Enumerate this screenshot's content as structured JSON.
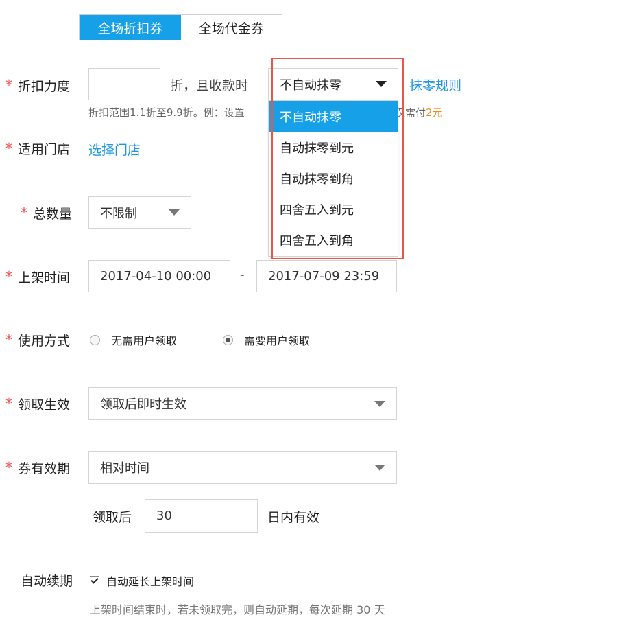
{
  "tabs": [
    {
      "label": "全场折扣券",
      "active": true
    },
    {
      "label": "全场代金券",
      "active": false
    }
  ],
  "required_mark": "*",
  "discount": {
    "label": "折扣力度",
    "value": "",
    "unit_text": "折，且收款时",
    "rounding_selected": "不自动抹零",
    "rounding_options": [
      "不自动抹零",
      "自动抹零到元",
      "自动抹零到角",
      "四舍五入到元",
      "四舍五入到角"
    ],
    "rules_link": "抹零规则",
    "hint_prefix": "折扣范围1.1折至9.9折。例：设置",
    "hint_hidden_suffix": "仅需付",
    "hint_amount": "2元"
  },
  "store": {
    "label": "适用门店",
    "link": "选择门店"
  },
  "quantity": {
    "label": "总数量",
    "value": "不限制"
  },
  "listing_time": {
    "label": "上架时间",
    "start": "2017-04-10 00:00",
    "separator": "-",
    "end": "2017-07-09 23:59"
  },
  "usage": {
    "label": "使用方式",
    "options": [
      {
        "label": "无需用户领取",
        "checked": false
      },
      {
        "label": "需要用户领取",
        "checked": true
      }
    ]
  },
  "effective": {
    "label": "领取生效",
    "value": "领取后即时生效"
  },
  "validity": {
    "label": "券有效期",
    "value": "相对时间",
    "prefix": "领取后",
    "days": "30",
    "suffix": "日内有效"
  },
  "auto_renew": {
    "label": "自动续期",
    "checkbox_label": "自动延长上架时间",
    "checked": true,
    "hint": "上架时间结束时，若未领取完，则自动延期，每次延期 30 天"
  },
  "colors": {
    "accent": "#16a0e8",
    "required": "#f04f4f",
    "link": "#1e97e0",
    "highlight": "#e8574a",
    "amount": "#f08a1c"
  }
}
